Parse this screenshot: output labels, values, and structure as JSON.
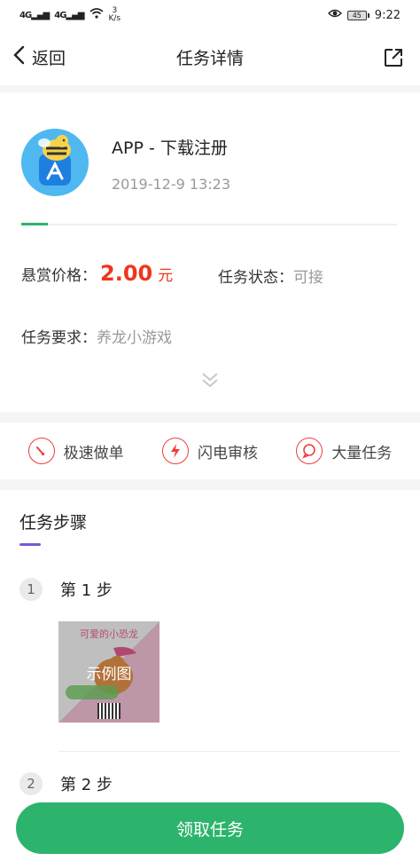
{
  "status_bar": {
    "signal1": "4G",
    "signal2": "4G",
    "net_speed_value": "3",
    "net_speed_unit": "K/s",
    "battery": "45",
    "time": "9:22"
  },
  "nav": {
    "back_label": "返回",
    "title": "任务详情"
  },
  "task": {
    "name": "APP - 下载注册",
    "date": "2019-12-9 13:23",
    "progress_percent": 7,
    "price_label": "悬赏价格：",
    "price_value": "2.00",
    "price_unit": "元",
    "status_label": "任务状态：",
    "status_value": "可接",
    "requirement_label": "任务要求：",
    "requirement_value": "养龙小游戏"
  },
  "features": [
    {
      "label": "极速做单",
      "icon": "speedometer-icon"
    },
    {
      "label": "闪电审核",
      "icon": "lightning-icon"
    },
    {
      "label": "大量任务",
      "icon": "chat-bubble-icon"
    }
  ],
  "steps_section": {
    "title": "任务步骤",
    "steps": [
      {
        "number": "1",
        "label": "第 1 步",
        "image_caption": "示例图",
        "image_text": "可爱的小恐龙"
      },
      {
        "number": "2",
        "label": "第 2 步"
      }
    ]
  },
  "cta": {
    "label": "领取任务"
  },
  "colors": {
    "accent_green": "#2db46c",
    "price_red": "#f0351c",
    "feature_red": "#f03c3c",
    "section_purple": "#7b57d6"
  }
}
